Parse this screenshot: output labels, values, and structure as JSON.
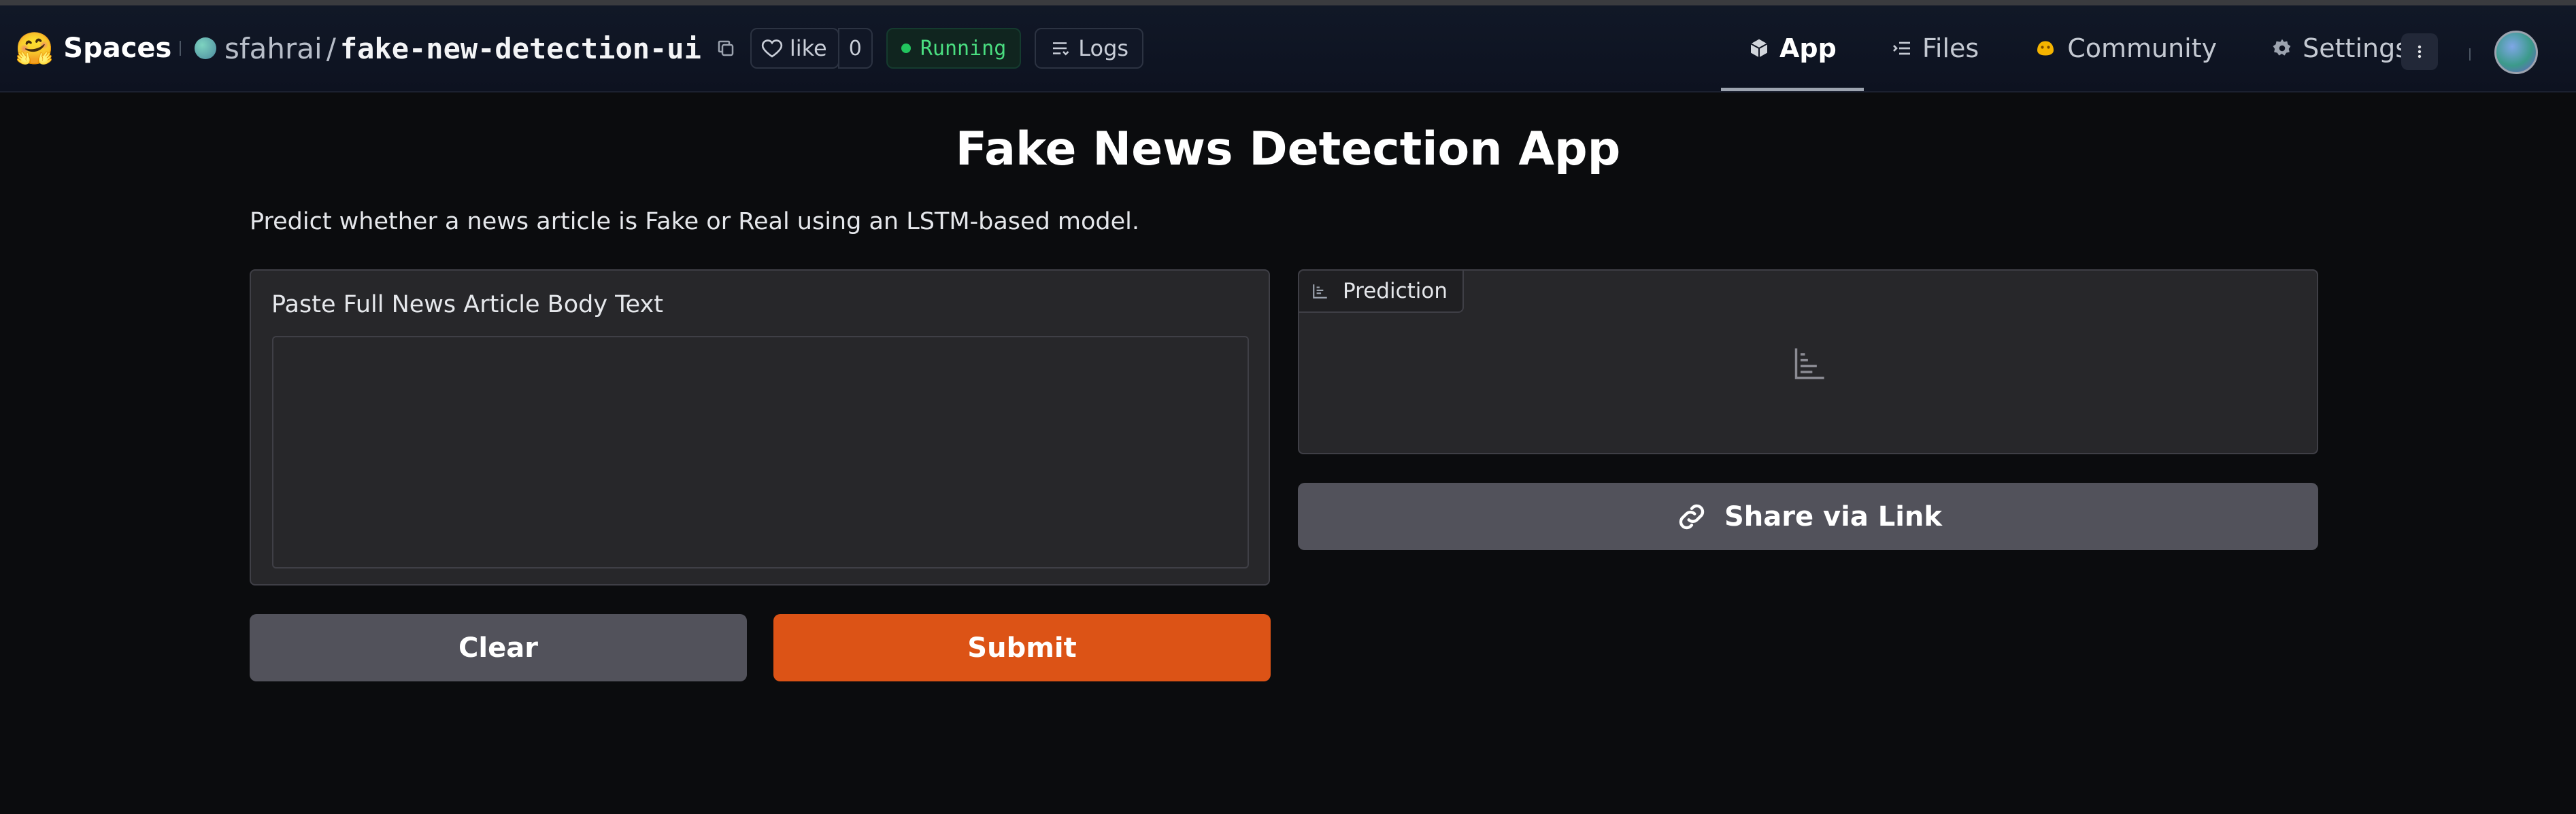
{
  "header": {
    "brand_emoji": "🤗",
    "brand": "Spaces",
    "owner": "sfahrai",
    "slash": "/",
    "repo": "fake-new-detection-ui",
    "like_label": "like",
    "like_count": "0",
    "status": "Running",
    "logs_label": "Logs",
    "nav": [
      {
        "label": "App",
        "icon": "cube-icon"
      },
      {
        "label": "Files",
        "icon": "files-icon"
      },
      {
        "label": "Community",
        "icon": "community-icon"
      },
      {
        "label": "Settings",
        "icon": "gear-icon"
      }
    ]
  },
  "main": {
    "title": "Fake News Detection App",
    "description": "Predict whether a news article is Fake or Real using an LSTM-based model.",
    "input": {
      "label": "Paste Full News Article Body Text",
      "value": ""
    },
    "output": {
      "label": "Prediction"
    },
    "share_label": "Share via Link",
    "clear_label": "Clear",
    "submit_label": "Submit"
  },
  "colors": {
    "accent": "#dc5316",
    "background": "#0b0c0e",
    "panel": "#27272a",
    "secondary_button": "#52525b",
    "status_green": "#22c55e"
  }
}
